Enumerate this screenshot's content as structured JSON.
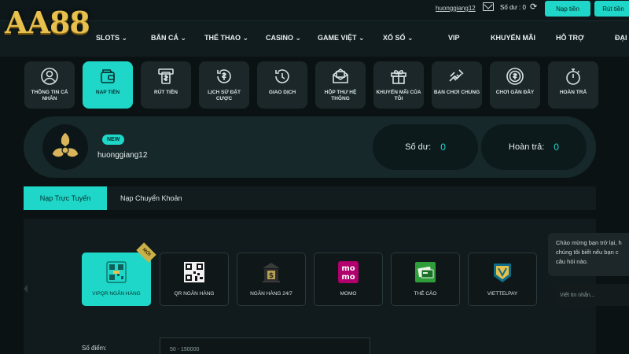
{
  "brand": {
    "logo": "AA88"
  },
  "topbar": {
    "username": "huonggiang12",
    "balance": "Số dư : 0",
    "deposit_button": "Nạp tiền",
    "withdraw_button": "Rút tiền"
  },
  "nav": {
    "items": [
      "SLOTS ⌄",
      "BẮN CÁ ⌄",
      "THỂ THAO ⌄",
      "CASINO ⌄",
      "GAME VIỆT ⌄",
      "XỔ SỐ ⌄",
      "VIP",
      "KHUYẾN MÃI",
      "HỖ TRỢ",
      "ĐẠI"
    ]
  },
  "account_menu": {
    "items": [
      {
        "label": "THÔNG TIN CÁ NHÂN",
        "icon": "person-icon"
      },
      {
        "label": "NẠP TIỀN",
        "icon": "wallet-icon"
      },
      {
        "label": "RÚT TIỀN",
        "icon": "withdraw-icon"
      },
      {
        "label": "LỊCH SỬ ĐẶT CƯỢC",
        "icon": "bet-history-icon"
      },
      {
        "label": "GIAO DỊCH",
        "icon": "transaction-history-icon"
      },
      {
        "label": "HỘP THƯ HỆ THỐNG",
        "icon": "mail-icon"
      },
      {
        "label": "KHUYẾN MÃI CỦA TÔI",
        "icon": "gift-icon"
      },
      {
        "label": "BẠN CHƠI CHUNG",
        "icon": "handshake-icon"
      },
      {
        "label": "CHƠI GẦN ĐÂY",
        "icon": "coin-icon"
      },
      {
        "label": "HOÀN TRẢ",
        "icon": "stopwatch-icon"
      }
    ]
  },
  "profile": {
    "badge": "NEW",
    "username": "huonggiang12",
    "balance_label": "Số dư:",
    "balance_value": "0",
    "rebate_label": "Hoàn trả:",
    "rebate_value": "0"
  },
  "deposit_tabs": [
    "Nạp Trực Tuyến",
    "Nạp Chuyển Khoản"
  ],
  "payment_methods": {
    "ribbon": "MỚI",
    "items": [
      {
        "label": "VIPQR NGÂN HÀNG",
        "icon": "vip-qr-icon"
      },
      {
        "label": "QR NGÂN HÀNG",
        "icon": "qr-code-icon"
      },
      {
        "label": "NGÂN HÀNG 24/7",
        "icon": "bank-icon"
      },
      {
        "label": "MOMO",
        "icon": "momo-icon",
        "text": "mo mo"
      },
      {
        "label": "THẺ CÀO",
        "icon": "scratch-card-icon"
      },
      {
        "label": "VIETTELPAY",
        "icon": "viettelpay-icon"
      }
    ]
  },
  "amount": {
    "label": "Số điểm:",
    "placeholder": "50 - 150000"
  },
  "chat": {
    "lines": [
      "Chào mừng bạn trở lại, h",
      "chúng tôi biết nếu bạn c",
      "câu hỏi nào."
    ],
    "input_placeholder": "Viết tin nhắn..."
  },
  "colors": {
    "accent": "#1fd7c8",
    "background": "#0b1213",
    "gold": "#e8c04e"
  }
}
